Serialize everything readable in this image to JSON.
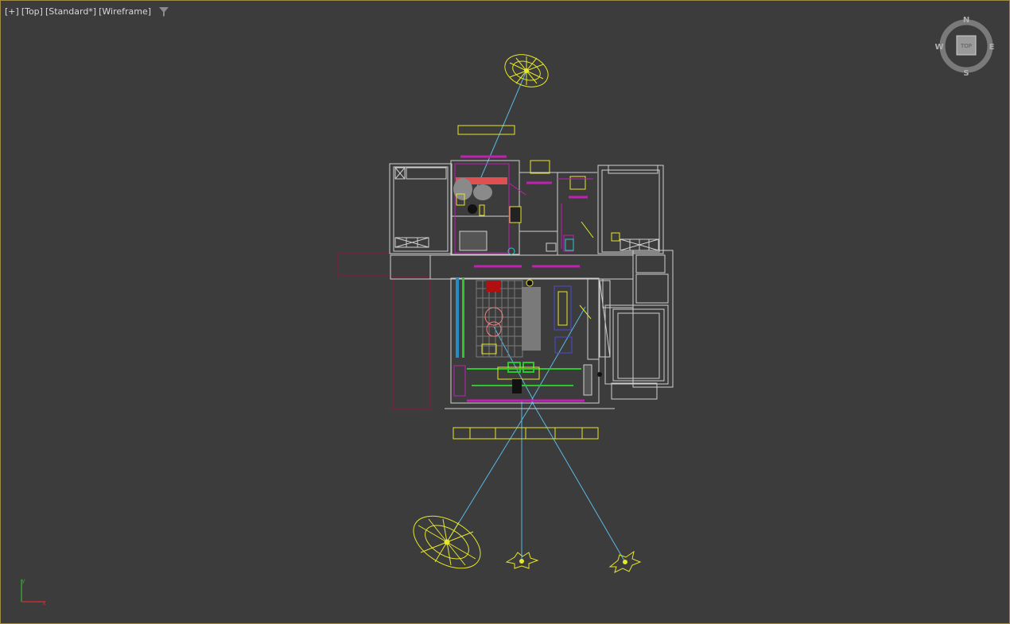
{
  "viewport": {
    "label_plus": "[+]",
    "label_view": "[Top]",
    "label_shading_style": "[Standard*]",
    "label_render_mode": "[Wireframe]",
    "filter_icon": "funnel-icon",
    "border_color": "#a08a46",
    "background": "#3c3c3c"
  },
  "viewcube": {
    "north": "N",
    "south": "S",
    "east": "E",
    "west": "W",
    "face": "TOP"
  },
  "axis_tripod": {
    "y_label": "y",
    "x_label": "x"
  },
  "colors": {
    "light_helper": "#e6e62a",
    "target_line": "#59b9e6",
    "wall": "#cfcfcf",
    "magenta": "#c021b0",
    "crimson": "#8a1a36",
    "green": "#2ec52e"
  }
}
